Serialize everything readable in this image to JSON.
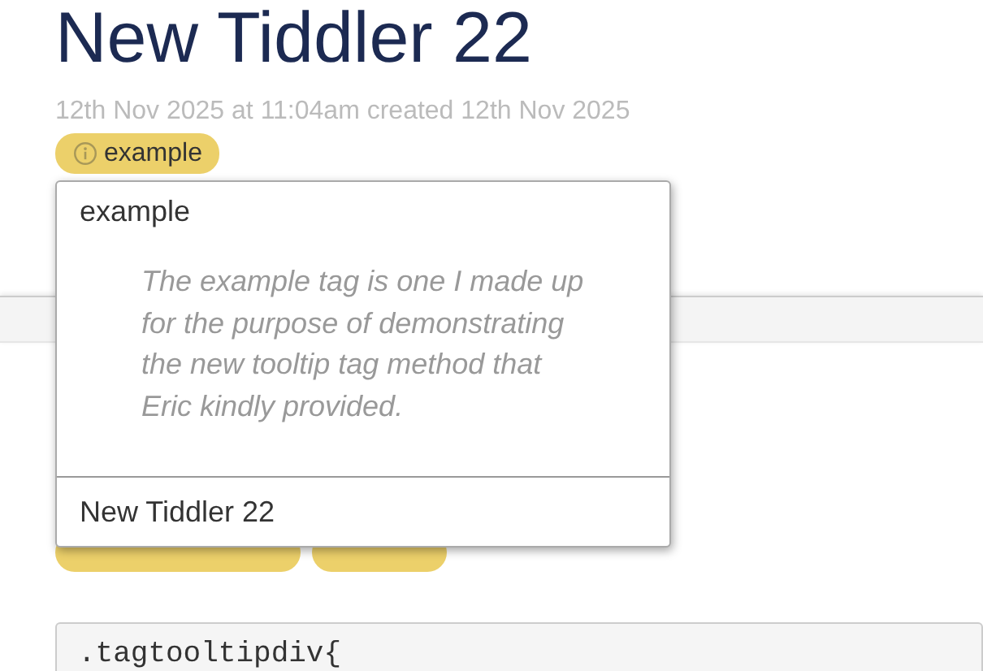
{
  "tiddler": {
    "title": "New Tiddler 22",
    "subtitle": "12th Nov 2025 at 11:04am created 12th Nov 2025",
    "tags": [
      "example"
    ]
  },
  "tag_dropdown": {
    "heading": "example",
    "description": [
      "The example tag is one I made up",
      "for the purpose of demonstrating",
      "the new tooltip tag method that",
      "Eric kindly provided."
    ],
    "items": [
      "New Tiddler 22"
    ]
  },
  "second_tiddler": {
    "code": ".tagtooltipdiv{"
  }
}
